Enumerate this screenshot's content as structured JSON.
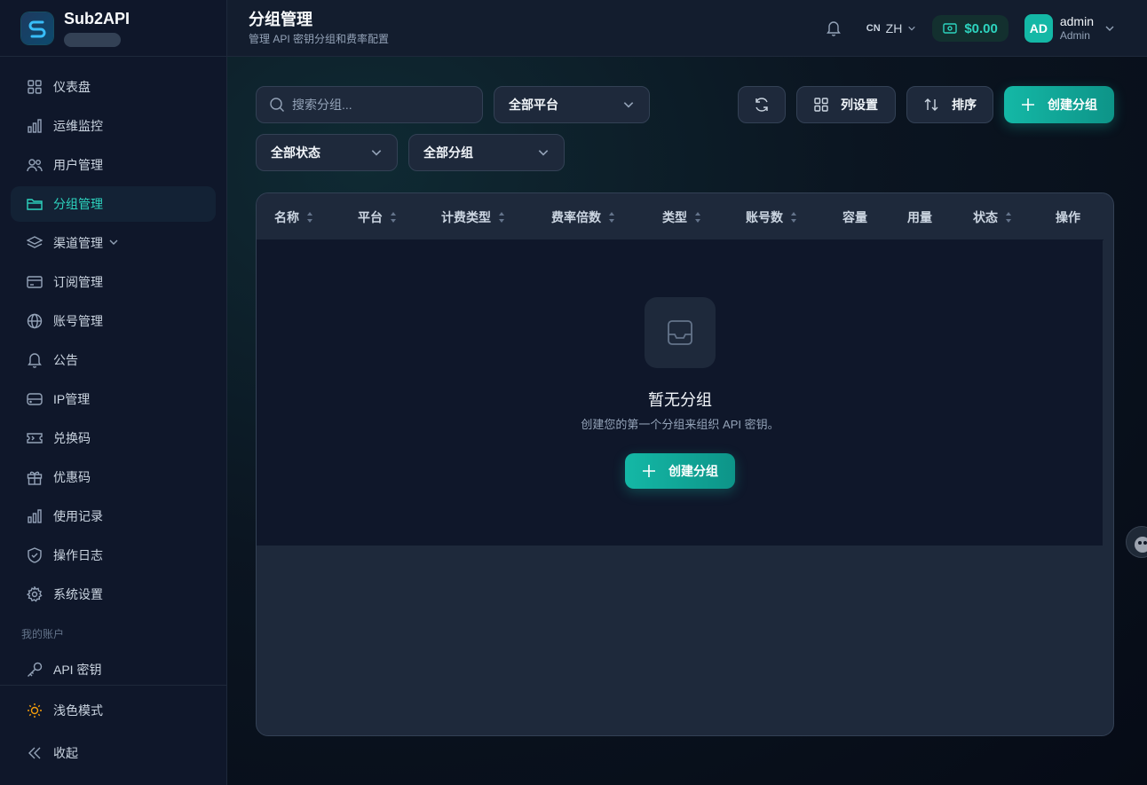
{
  "brand": {
    "name": "Sub2API"
  },
  "sidebar": {
    "items": [
      {
        "label": "仪表盘",
        "icon": "dashboard-grid-icon"
      },
      {
        "label": "运维监控",
        "icon": "bar-chart-icon"
      },
      {
        "label": "用户管理",
        "icon": "users-icon"
      },
      {
        "label": "分组管理",
        "icon": "folder-icon"
      },
      {
        "label": "渠道管理",
        "icon": "layers-icon"
      },
      {
        "label": "订阅管理",
        "icon": "credit-card-icon"
      },
      {
        "label": "账号管理",
        "icon": "globe-icon"
      },
      {
        "label": "公告",
        "icon": "bell-icon"
      },
      {
        "label": "IP管理",
        "icon": "server-icon"
      },
      {
        "label": "兑换码",
        "icon": "ticket-icon"
      },
      {
        "label": "优惠码",
        "icon": "gift-icon"
      },
      {
        "label": "使用记录",
        "icon": "bar-chart-icon"
      },
      {
        "label": "操作日志",
        "icon": "shield-icon"
      },
      {
        "label": "系统设置",
        "icon": "gear-icon"
      }
    ],
    "active_index": 3,
    "section_label": "我的账户",
    "account_items": [
      {
        "label": "API 密钥",
        "icon": "key-icon"
      }
    ],
    "bottom": {
      "theme_label": "浅色模式",
      "collapse_label": "收起"
    }
  },
  "header": {
    "title": "分组管理",
    "subtitle": "管理 API 密钥分组和费率配置",
    "lang_flag": "CN",
    "lang": "ZH",
    "balance": "$0.00",
    "user": {
      "initials": "AD",
      "name": "admin",
      "role": "Admin"
    }
  },
  "toolbar": {
    "search_placeholder": "搜索分组...",
    "platform_filter": "全部平台",
    "status_filter": "全部状态",
    "group_filter": "全部分组",
    "columns_label": "列设置",
    "sort_label": "排序",
    "create_label": "创建分组"
  },
  "table": {
    "columns": [
      "名称",
      "平台",
      "计费类型",
      "费率倍数",
      "类型",
      "账号数",
      "容量",
      "用量",
      "状态",
      "操作"
    ],
    "empty_title": "暂无分组",
    "empty_desc": "创建您的第一个分组来组织 API 密钥。",
    "empty_button": "创建分组"
  },
  "colors": {
    "accent": "#14b8a6",
    "background": "#0b1220",
    "surface": "#1e293b"
  }
}
